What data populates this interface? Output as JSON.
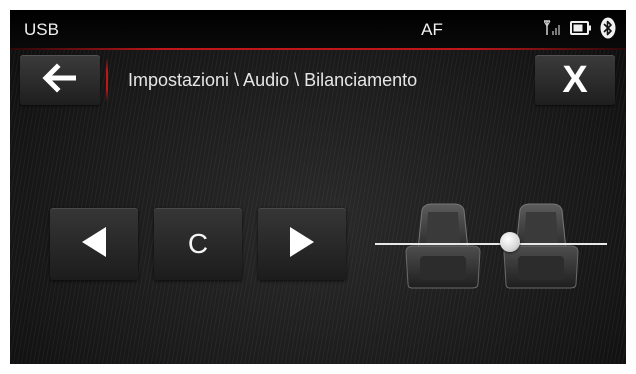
{
  "status_bar": {
    "source": "USB",
    "af": "AF"
  },
  "header": {
    "breadcrumb": "Impostazioni \\ Audio \\ Bilanciamento",
    "close_label": "X"
  },
  "balance": {
    "center_label": "C",
    "level": 0.58
  },
  "icons": {
    "back": "arrow-left-icon",
    "close": "close-icon",
    "signal": "signal-icon",
    "battery": "battery-icon",
    "bluetooth": "bluetooth-icon",
    "left": "triangle-left-icon",
    "right": "triangle-right-icon",
    "seats": "car-seats-icon"
  },
  "colors": {
    "accent": "#c0161a",
    "background": "#1a1a1a",
    "text": "#f0f0f0"
  }
}
